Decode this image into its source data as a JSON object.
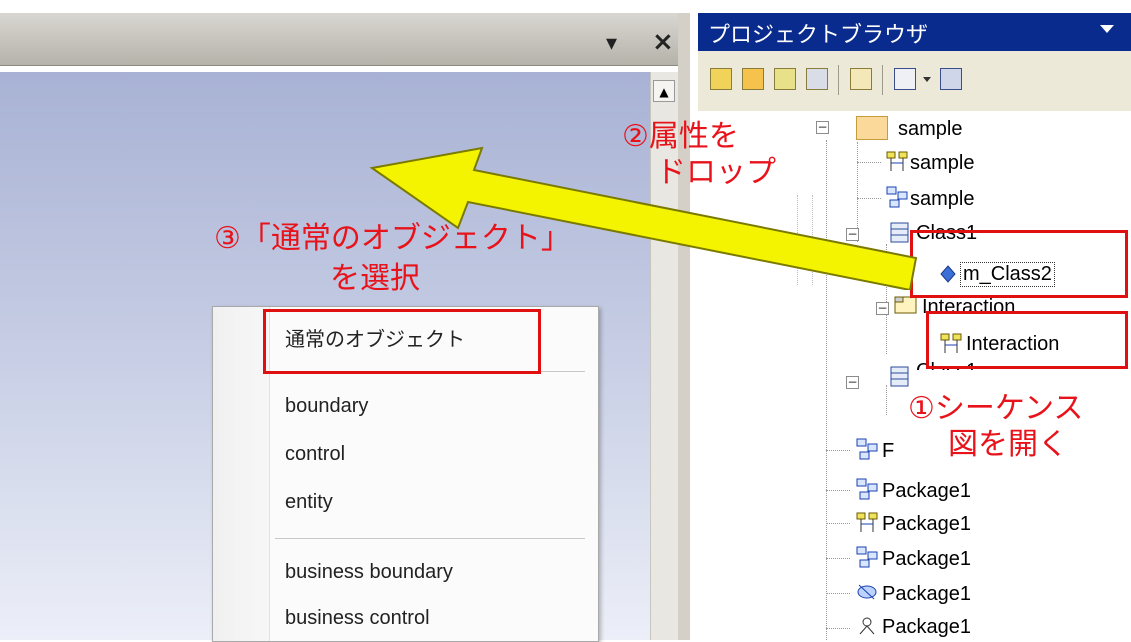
{
  "left_pane": {
    "dropdown_glyph": "▾",
    "close_glyph": "×",
    "scroll_up_glyph": "▲"
  },
  "context_menu": {
    "items": [
      {
        "label": "通常のオブジェクト"
      },
      {
        "label": "boundary"
      },
      {
        "label": "control"
      },
      {
        "label": "entity"
      },
      {
        "label": "business boundary"
      },
      {
        "label": "business control"
      }
    ]
  },
  "project_browser": {
    "title": "プロジェクトブラウザ",
    "toolbar_icons": [
      "new-package-icon",
      "new-view-icon",
      "new-diagram-icon",
      "new-element-icon",
      "find-icon",
      "document-icon",
      "options-icon"
    ],
    "tree": [
      {
        "label": "sample",
        "icon": "package-folder-icon"
      },
      {
        "label": "sample",
        "icon": "sequence-diagram-icon"
      },
      {
        "label": "sample",
        "icon": "class-diagram-icon"
      },
      {
        "label": "Class1",
        "icon": "class-icon"
      },
      {
        "label": "m_Class2",
        "icon": "attribute-icon"
      },
      {
        "label": "Interaction",
        "icon": "interaction-icon"
      },
      {
        "label": "Interaction",
        "icon": "sequence-diagram-icon"
      },
      {
        "label": "Class1",
        "icon": "class-icon"
      },
      {
        "label": "F",
        "icon": "class-diagram-icon"
      },
      {
        "label": "Package1",
        "icon": "class-diagram-icon"
      },
      {
        "label": "Package1",
        "icon": "sequence-diagram-icon"
      },
      {
        "label": "Package1",
        "icon": "class-diagram-icon"
      },
      {
        "label": "Package1",
        "icon": "usecase-diagram-icon"
      },
      {
        "label": "Package1",
        "icon": "activity-diagram-icon"
      }
    ]
  },
  "annotations": {
    "step1_line1": "①シーケンス",
    "step1_line2": "図を開く",
    "step2_line1": "②属性を",
    "step2_line2": "ドロップ",
    "step3_line1": "③「通常のオブジェクト」",
    "step3_line2": "を選択"
  },
  "colors": {
    "annotation_red": "#e8131a",
    "arrow_fill": "#f4f400",
    "browser_title_bg": "#0a2b8e"
  }
}
